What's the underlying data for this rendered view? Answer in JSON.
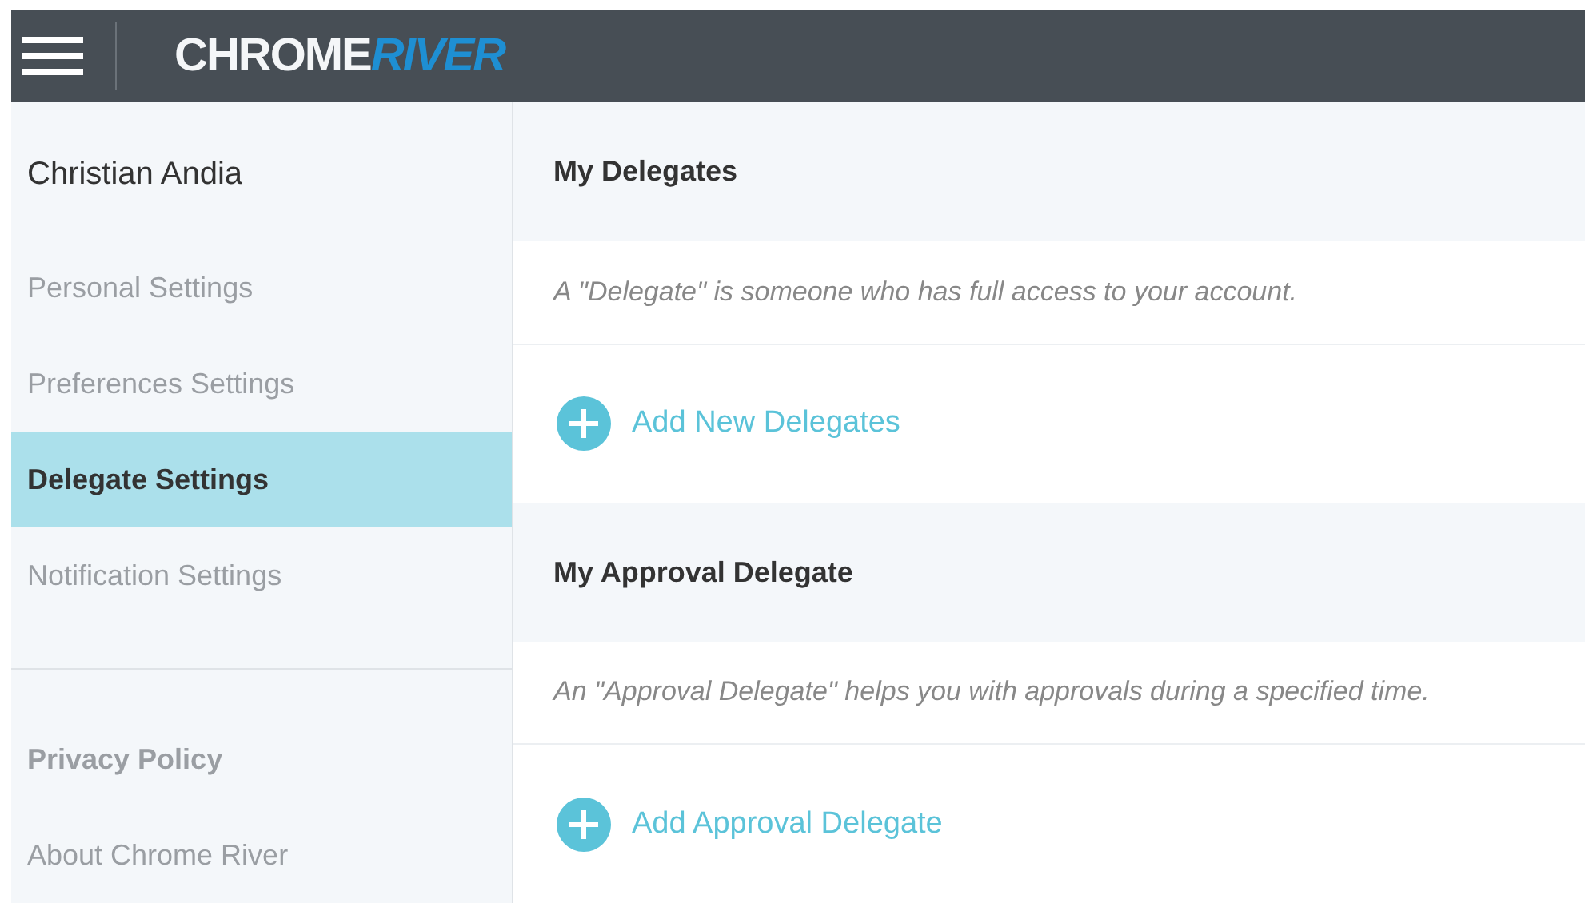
{
  "header": {
    "logo": [
      {
        "text": "CHROME",
        "kind": "light"
      },
      {
        "text": "RIVER",
        "kind": "accent"
      }
    ]
  },
  "sidebar": {
    "user_name": "Christian Andia",
    "items": [
      {
        "label": "Personal Settings",
        "selected": false
      },
      {
        "label": "Preferences Settings",
        "selected": false
      },
      {
        "label": "Delegate Settings",
        "selected": true
      },
      {
        "label": "Notification Settings",
        "selected": false
      }
    ],
    "footer_links": [
      {
        "label": "Privacy Policy",
        "kind": "bold"
      },
      {
        "label": "About Chrome River",
        "kind": "plain"
      }
    ]
  },
  "sections": [
    {
      "title": "My Delegates",
      "description": "A \"Delegate\" is someone who has full access to your account.",
      "action": "Add New Delegates"
    },
    {
      "title": "My Approval Delegate",
      "description": "An \"Approval Delegate\" helps you with approvals during a specified time.",
      "action": "Add Approval Delegate"
    }
  ]
}
